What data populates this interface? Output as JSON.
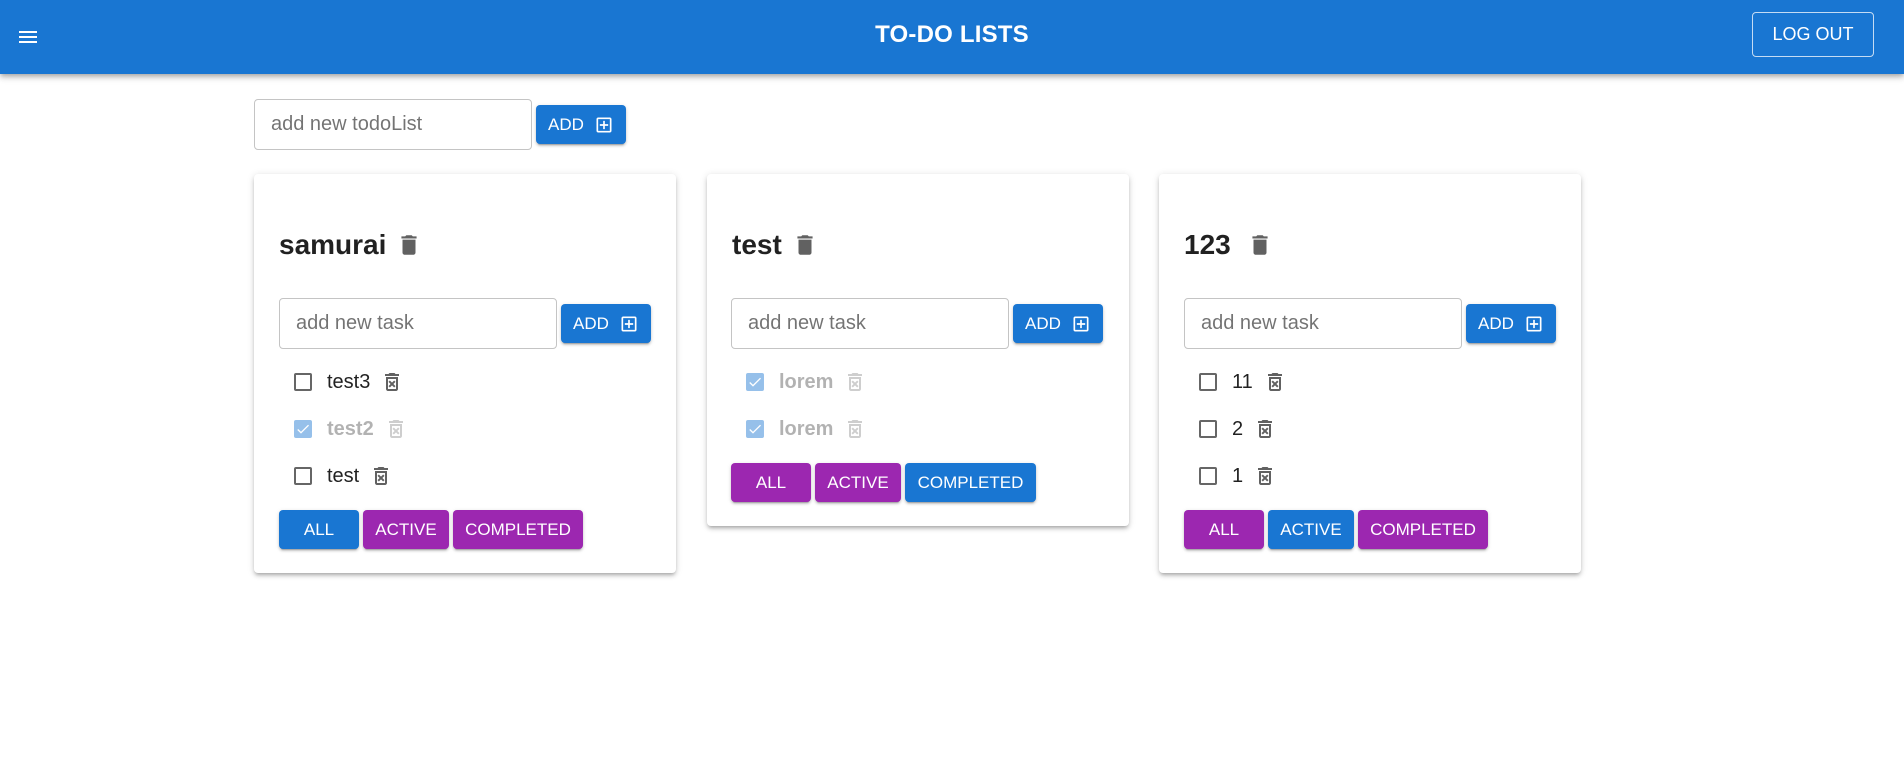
{
  "header": {
    "title": "TO-DO LISTS",
    "logout_label": "LOG OUT"
  },
  "new_list": {
    "placeholder": "add new todoList",
    "add_label": "ADD"
  },
  "lists": [
    {
      "title": "samurai",
      "task_placeholder": "add new task",
      "add_label": "ADD",
      "tasks": [
        {
          "label": "test3",
          "done": false
        },
        {
          "label": "test2",
          "done": true
        },
        {
          "label": "test",
          "done": false
        }
      ],
      "filters": [
        {
          "label": "ALL",
          "selected": true
        },
        {
          "label": "ACTIVE",
          "selected": false
        },
        {
          "label": "COMPLETED",
          "selected": false
        }
      ]
    },
    {
      "title": "test",
      "task_placeholder": "add new task",
      "add_label": "ADD",
      "tasks": [
        {
          "label": "lorem",
          "done": true
        },
        {
          "label": "lorem",
          "done": true
        }
      ],
      "filters": [
        {
          "label": "ALL",
          "selected": false
        },
        {
          "label": "ACTIVE",
          "selected": false
        },
        {
          "label": "COMPLETED",
          "selected": true
        }
      ]
    },
    {
      "title": "123",
      "task_placeholder": "add new task",
      "add_label": "ADD",
      "tasks": [
        {
          "label": "11",
          "done": false
        },
        {
          "label": "2",
          "done": false
        },
        {
          "label": "1",
          "done": false
        }
      ],
      "filters": [
        {
          "label": "ALL",
          "selected": false
        },
        {
          "label": "ACTIVE",
          "selected": true
        },
        {
          "label": "COMPLETED",
          "selected": false
        }
      ]
    }
  ],
  "colors": {
    "primary": "#1976d2",
    "secondary": "#9c27b0"
  },
  "icons": {
    "menu": "menu-icon",
    "add": "add-box-icon",
    "delete_list": "delete-icon",
    "delete_task": "delete-forever-icon",
    "check": "check-icon"
  }
}
